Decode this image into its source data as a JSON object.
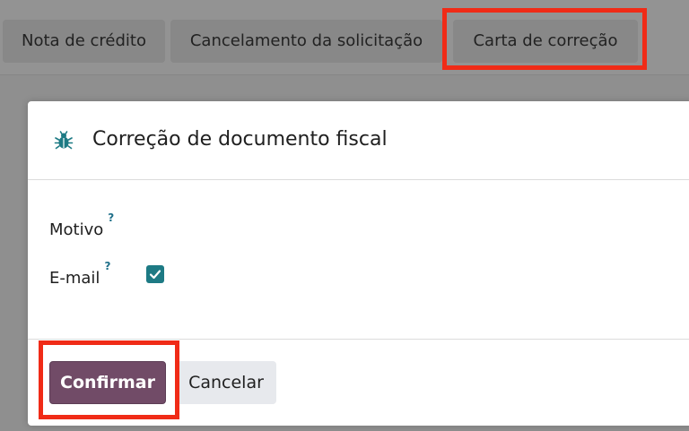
{
  "toolbar": {
    "buttons": [
      {
        "label": "Nota de crédito"
      },
      {
        "label": "Cancelamento da solicitação"
      },
      {
        "label": "Carta de correção"
      }
    ]
  },
  "modal": {
    "icon": "bug-icon",
    "title": "Correção de documento fiscal",
    "fields": {
      "motivo": {
        "label": "Motivo",
        "help": "?",
        "value": ""
      },
      "email": {
        "label": "E-mail",
        "help": "?",
        "checked": true
      }
    },
    "footer": {
      "confirm_label": "Confirmar",
      "cancel_label": "Cancelar"
    }
  },
  "colors": {
    "primary": "#714b67",
    "accent": "#1d7a84",
    "highlight": "#f02b17"
  }
}
